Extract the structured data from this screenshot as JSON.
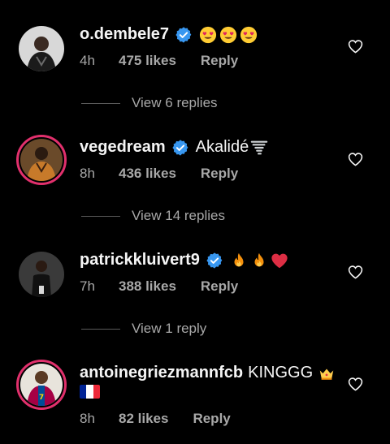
{
  "comments": [
    {
      "username": "o.dembele7",
      "text": "",
      "emojis": [
        "heart-eyes",
        "heart-eyes",
        "heart-eyes"
      ],
      "time": "4h",
      "likes": "475 likes",
      "reply": "Reply",
      "view_replies": "View 6 replies"
    },
    {
      "username": "vegedream",
      "text": "Akalidé",
      "emojis": [
        "tornado"
      ],
      "time": "8h",
      "likes": "436 likes",
      "reply": "Reply",
      "view_replies": "View 14 replies"
    },
    {
      "username": "patrickkluivert9",
      "text": "",
      "emojis": [
        "fire",
        "fire",
        "red-heart"
      ],
      "time": "7h",
      "likes": "388 likes",
      "reply": "Reply",
      "view_replies": "View 1 reply"
    },
    {
      "username": "antoinegriezmannfcb",
      "text": "KINGGG",
      "emojis": [
        "crown",
        "flag-france"
      ],
      "time": "8h",
      "likes": "82 likes",
      "reply": "Reply",
      "view_replies": ""
    }
  ],
  "colors": {
    "background": "#000000",
    "text": "#f5f5f5",
    "secondary": "#a8a8a8",
    "verified": "#3897f0",
    "story_ring": "#e1306c"
  },
  "icons": {
    "like": "heart-outline-icon",
    "verified": "verified-badge-icon"
  }
}
